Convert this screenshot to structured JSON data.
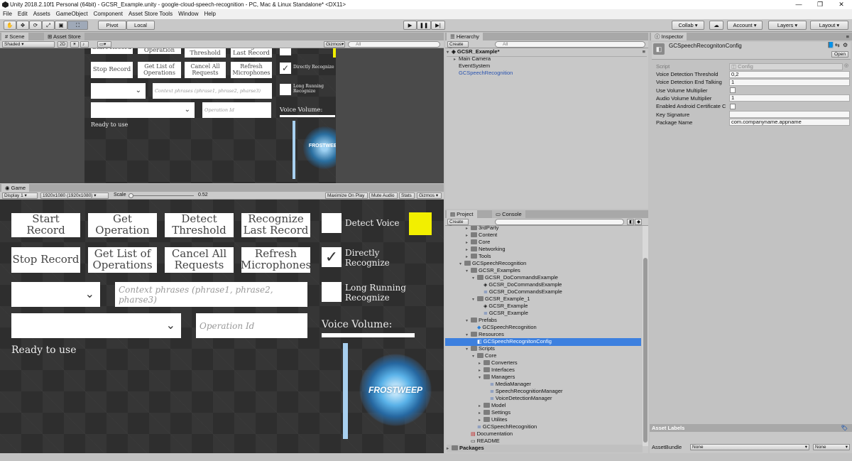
{
  "window": {
    "title": "Unity 2018.2.10f1 Personal (64bit) - GCSR_Example.unity - google-cloud-speech-recognition - PC, Mac & Linux Standalone* <DX11>",
    "minimize": "—",
    "maximize": "❐",
    "close": "✕"
  },
  "menu": [
    "File",
    "Edit",
    "Assets",
    "GameObject",
    "Component",
    "Asset Store Tools",
    "Window",
    "Help"
  ],
  "toolbar": {
    "pivot": "Pivot",
    "local": "Local",
    "collab": "Collab ▾",
    "account": "Account",
    "layers": "Layers",
    "layout": "Layout",
    "tool_icons": [
      "hand-icon",
      "move-icon",
      "rotate-icon",
      "scale-icon",
      "rect-icon",
      "transform-icon"
    ]
  },
  "scene": {
    "tab_scene": "Scene",
    "tab_store": "Asset Store",
    "shading": "Shaded",
    "mode2d": "2D",
    "gizmos": "Gizmos",
    "search": "All"
  },
  "game_ui": {
    "start_record": "Start Record",
    "get_operation": "Get Operation",
    "detect_threshold": "Detect Threshold",
    "recognize_last": "Recognize Last Record",
    "detect_voice": "Detect Voice",
    "stop_record": "Stop Record",
    "get_list_ops": "Get List of Operations",
    "cancel_all": "Cancel All Requests",
    "refresh_mics": "Refresh Microphones",
    "directly_recognize": "Directly Recognize",
    "context_placeholder": "Context phrases (phrase1, phrase2, pharse3)",
    "long_running": "Long Running Recognize",
    "operation_placeholder": "Operation Id",
    "voice_volume": "Voice Volume:",
    "status": "Ready to use",
    "logo": "FROSTWEEP",
    "yellow": "#f2ef00"
  },
  "game": {
    "tab": "Game",
    "display": "Display 1",
    "resolution": "1920x1080 (1920x1080)",
    "scale_label": "Scale",
    "scale_value": "0.52",
    "scale_fraction": 0.52,
    "maximize": "Maximize On Play",
    "mute": "Mute Audio",
    "stats": "Stats",
    "gizmos": "Gizmos"
  },
  "hierarchy": {
    "tab": "Hierarchy",
    "create": "Create",
    "search": "All",
    "scene": "GCSR_Example*",
    "items": [
      "Main Camera",
      "EventSystem",
      "GCSpeechRecognition"
    ]
  },
  "project": {
    "tab_project": "Project",
    "tab_console": "Console",
    "create": "Create",
    "items": [
      {
        "label": "3rdParty",
        "indent": 3,
        "kind": "folder",
        "arrow": "▸"
      },
      {
        "label": "Content",
        "indent": 3,
        "kind": "folder",
        "arrow": "▸"
      },
      {
        "label": "Core",
        "indent": 3,
        "kind": "folder",
        "arrow": "▸"
      },
      {
        "label": "Networking",
        "indent": 3,
        "kind": "folder",
        "arrow": "▸"
      },
      {
        "label": "Tools",
        "indent": 3,
        "kind": "folder",
        "arrow": "▸"
      },
      {
        "label": "GCSpeechRecognition",
        "indent": 2,
        "kind": "folder",
        "arrow": "▾"
      },
      {
        "label": "GCSR_Examples",
        "indent": 3,
        "kind": "folder",
        "arrow": "▾"
      },
      {
        "label": "GCSR_DoCommandsExample",
        "indent": 4,
        "kind": "folder",
        "arrow": "▾"
      },
      {
        "label": "GCSR_DoCommandsExample",
        "indent": 5,
        "kind": "unity",
        "arrow": ""
      },
      {
        "label": "GCSR_DoCommandsExample",
        "indent": 5,
        "kind": "script",
        "arrow": ""
      },
      {
        "label": "GCSR_Example_1",
        "indent": 4,
        "kind": "folder",
        "arrow": "▾"
      },
      {
        "label": "GCSR_Example",
        "indent": 5,
        "kind": "unity",
        "arrow": ""
      },
      {
        "label": "GCSR_Example",
        "indent": 5,
        "kind": "script",
        "arrow": ""
      },
      {
        "label": "Prefabs",
        "indent": 3,
        "kind": "folder",
        "arrow": "▾"
      },
      {
        "label": "GCSpeechRecognition",
        "indent": 4,
        "kind": "prefab",
        "arrow": ""
      },
      {
        "label": "Resources",
        "indent": 3,
        "kind": "folder",
        "arrow": "▾"
      },
      {
        "label": "GCSpeechRecognitonConfig",
        "indent": 4,
        "kind": "asset",
        "arrow": "",
        "selected": true
      },
      {
        "label": "Scripts",
        "indent": 3,
        "kind": "folder",
        "arrow": "▾"
      },
      {
        "label": "Core",
        "indent": 4,
        "kind": "folder",
        "arrow": "▾"
      },
      {
        "label": "Converters",
        "indent": 5,
        "kind": "folder",
        "arrow": "▸"
      },
      {
        "label": "Interfaces",
        "indent": 5,
        "kind": "folder",
        "arrow": "▸"
      },
      {
        "label": "Managers",
        "indent": 5,
        "kind": "folder",
        "arrow": "▾"
      },
      {
        "label": "MediaManager",
        "indent": 6,
        "kind": "script",
        "arrow": ""
      },
      {
        "label": "SpeechRecognitionManager",
        "indent": 6,
        "kind": "script",
        "arrow": ""
      },
      {
        "label": "VoiceDetectionManager",
        "indent": 6,
        "kind": "script",
        "arrow": ""
      },
      {
        "label": "Model",
        "indent": 5,
        "kind": "folder",
        "arrow": "▸"
      },
      {
        "label": "Settings",
        "indent": 5,
        "kind": "folder",
        "arrow": "▸"
      },
      {
        "label": "Utilites",
        "indent": 5,
        "kind": "folder",
        "arrow": "▸"
      },
      {
        "label": "GCSpeechRecognition",
        "indent": 4,
        "kind": "script",
        "arrow": ""
      },
      {
        "label": "Documentation",
        "indent": 3,
        "kind": "pdf",
        "arrow": ""
      },
      {
        "label": "README",
        "indent": 3,
        "kind": "text",
        "arrow": ""
      }
    ],
    "packages": "Packages"
  },
  "inspector": {
    "tab": "Inspector",
    "title": "GCSpeechRecognitonConfig",
    "open": "Open",
    "script_label": "Script",
    "script_value": "Config",
    "fields": [
      {
        "label": "Voice Detection Threshold",
        "type": "text",
        "value": "0,2"
      },
      {
        "label": "Voice Detection End Talking",
        "type": "text",
        "value": "1"
      },
      {
        "label": "Use Volume Multiplier",
        "type": "check",
        "value": ""
      },
      {
        "label": "Audio Volume Multiplier",
        "type": "text",
        "value": "1"
      },
      {
        "label": "Enabled Android Certificate C",
        "type": "check",
        "value": ""
      },
      {
        "label": "Key Signature",
        "type": "text",
        "value": ""
      },
      {
        "label": "Package Name",
        "type": "text",
        "value": "com.companyname.appname"
      }
    ],
    "asset_labels": "Asset Labels",
    "asset_bundle": "AssetBundle",
    "none1": "None",
    "none2": "None"
  }
}
